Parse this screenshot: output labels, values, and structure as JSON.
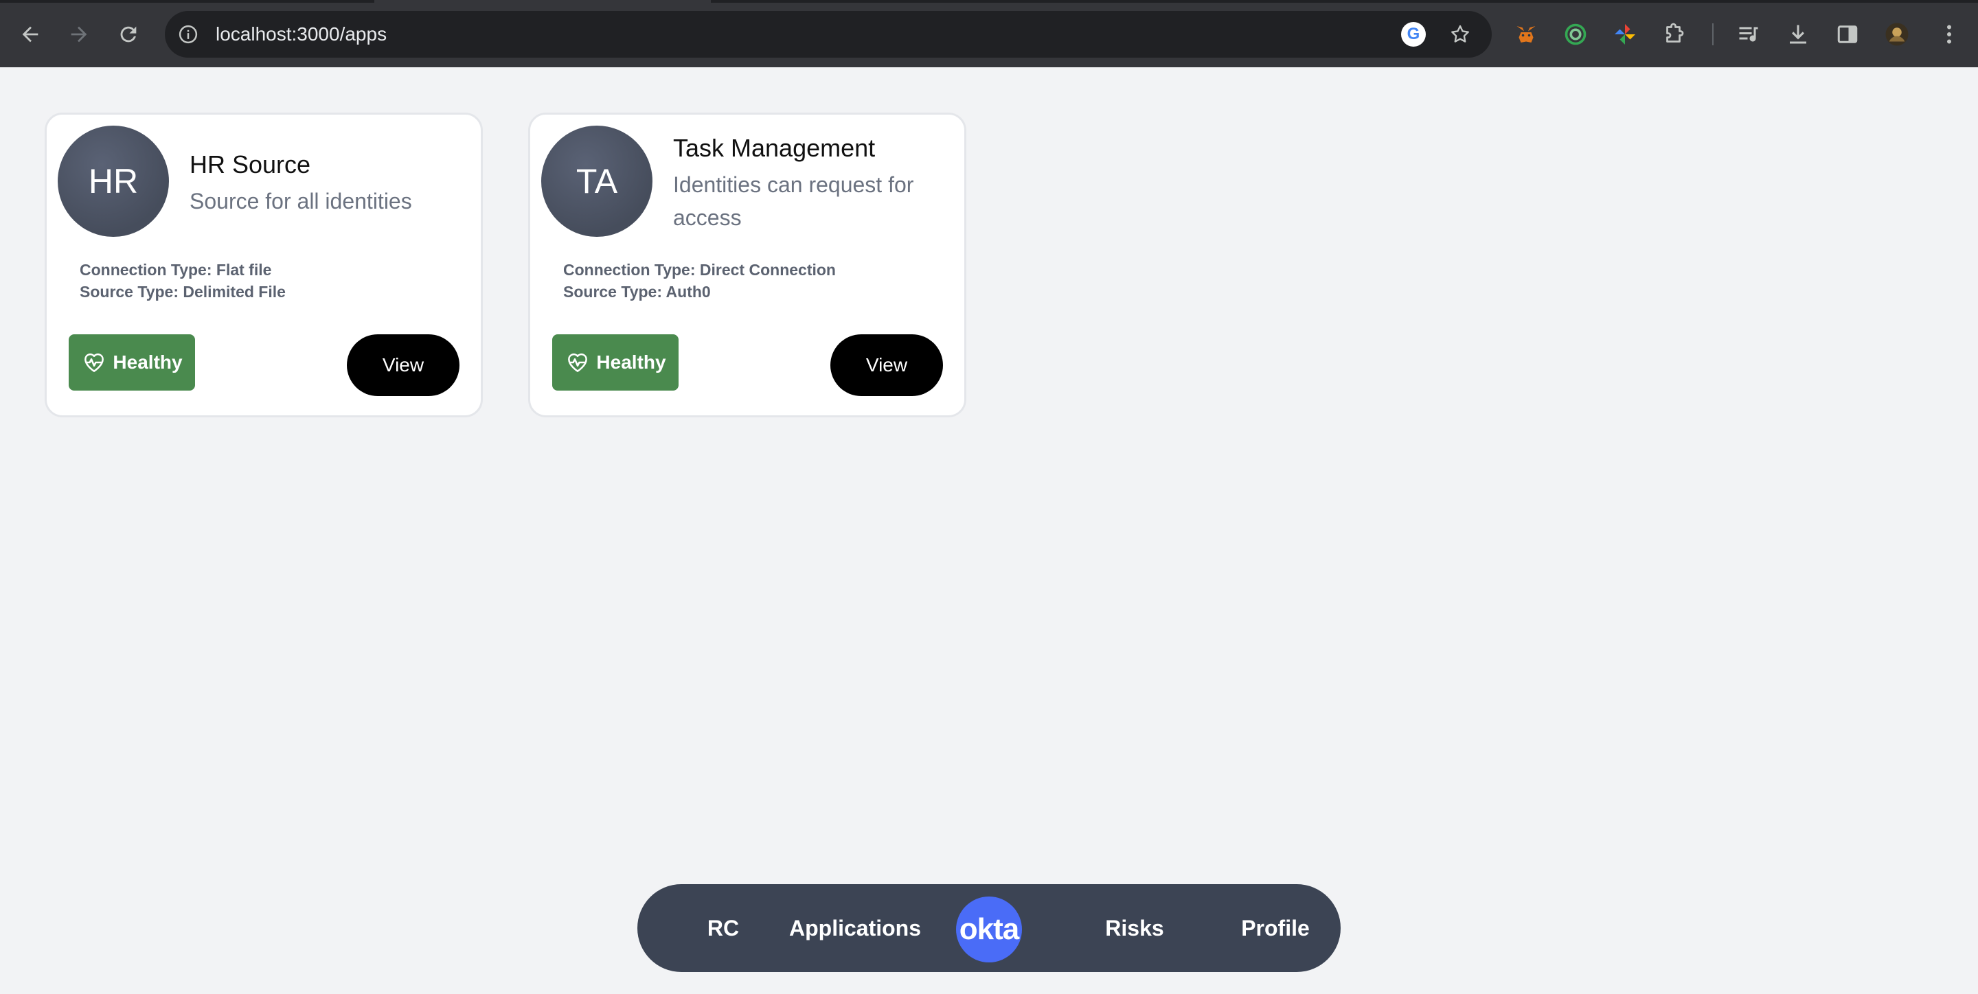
{
  "browser": {
    "url": "localhost:3000/apps"
  },
  "apps": [
    {
      "initials": "HR",
      "name": "HR Source",
      "description": "Source for all identities",
      "connection_type": "Connection Type: Flat file",
      "source_type": "Source Type: Delimited File",
      "status": "Healthy",
      "view_label": "View"
    },
    {
      "initials": "TA",
      "name": "Task Management",
      "description": "Identities can request for access",
      "connection_type": "Connection Type: Direct Connection",
      "source_type": "Source Type: Auth0",
      "status": "Healthy",
      "view_label": "View"
    }
  ],
  "bottom_nav": {
    "items": [
      "RC",
      "Applications",
      "Risks",
      "Profile"
    ],
    "logo": "okta"
  },
  "colors": {
    "healthy": "#4a8a4e",
    "avatar": "#464d5c",
    "nav_bg": "#3c4454",
    "okta_blue": "#4a6cf7"
  }
}
